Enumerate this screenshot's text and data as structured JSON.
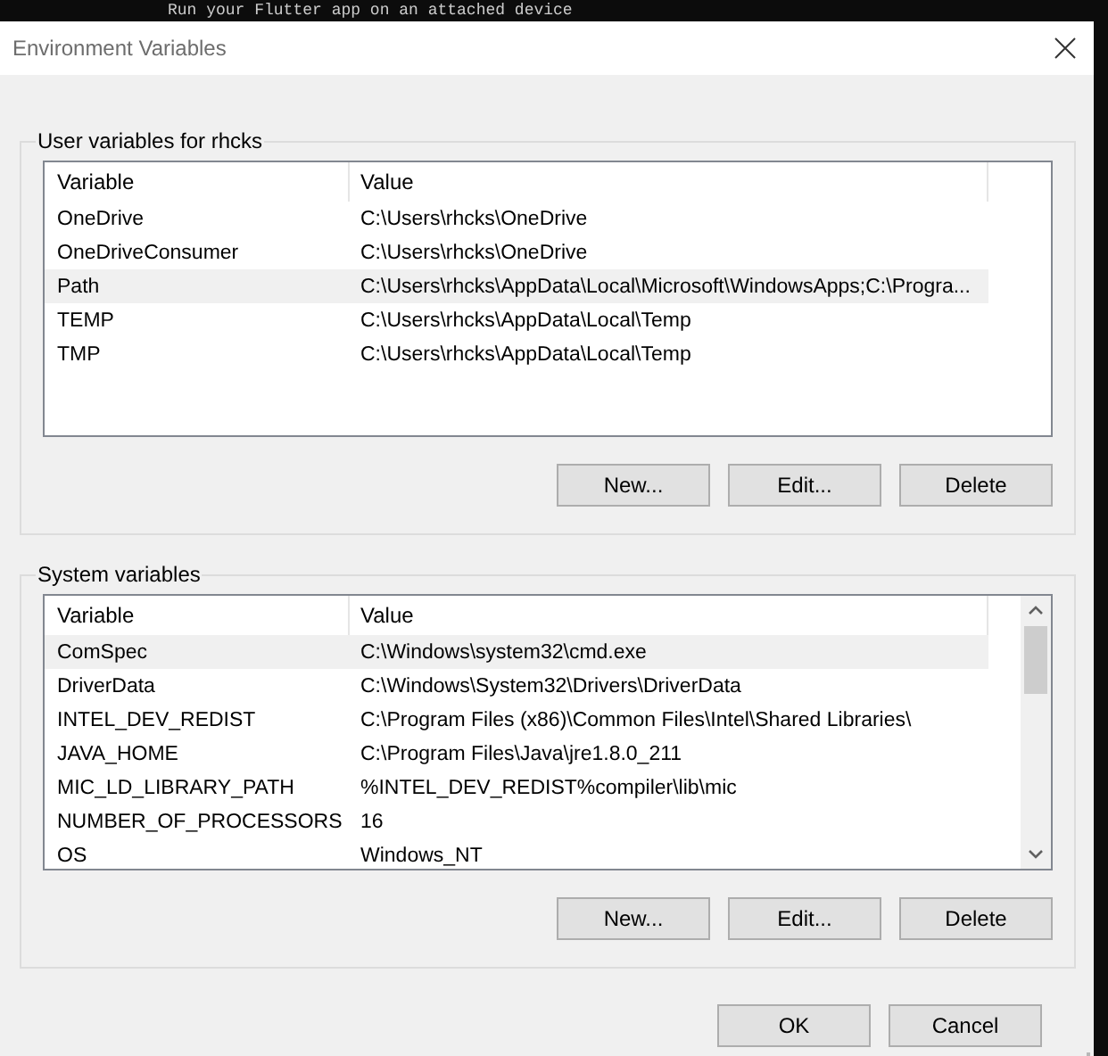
{
  "background": {
    "terminal_text": "Run your Flutter app on an attached device"
  },
  "window": {
    "title": "Environment Variables"
  },
  "user_variables": {
    "title": "User variables for rhcks",
    "columns": [
      "Variable",
      "Value"
    ],
    "rows": [
      {
        "variable": "OneDrive",
        "value": "C:\\Users\\rhcks\\OneDrive",
        "selected": false
      },
      {
        "variable": "OneDriveConsumer",
        "value": "C:\\Users\\rhcks\\OneDrive",
        "selected": false
      },
      {
        "variable": "Path",
        "value": "C:\\Users\\rhcks\\AppData\\Local\\Microsoft\\WindowsApps;C:\\Progra...",
        "selected": true
      },
      {
        "variable": "TEMP",
        "value": "C:\\Users\\rhcks\\AppData\\Local\\Temp",
        "selected": false
      },
      {
        "variable": "TMP",
        "value": "C:\\Users\\rhcks\\AppData\\Local\\Temp",
        "selected": false
      }
    ],
    "buttons": [
      "New...",
      "Edit...",
      "Delete"
    ]
  },
  "system_variables": {
    "title": "System variables",
    "columns": [
      "Variable",
      "Value"
    ],
    "rows": [
      {
        "variable": "ComSpec",
        "value": "C:\\Windows\\system32\\cmd.exe",
        "selected": true
      },
      {
        "variable": "DriverData",
        "value": "C:\\Windows\\System32\\Drivers\\DriverData",
        "selected": false
      },
      {
        "variable": "INTEL_DEV_REDIST",
        "value": "C:\\Program Files (x86)\\Common Files\\Intel\\Shared Libraries\\",
        "selected": false
      },
      {
        "variable": "JAVA_HOME",
        "value": "C:\\Program Files\\Java\\jre1.8.0_211",
        "selected": false
      },
      {
        "variable": "MIC_LD_LIBRARY_PATH",
        "value": "%INTEL_DEV_REDIST%compiler\\lib\\mic",
        "selected": false
      },
      {
        "variable": "NUMBER_OF_PROCESSORS",
        "value": "16",
        "selected": false
      },
      {
        "variable": "OS",
        "value": "Windows_NT",
        "selected": false
      }
    ],
    "buttons": [
      "New...",
      "Edit...",
      "Delete"
    ]
  },
  "buttons": [
    "OK",
    "Cancel"
  ]
}
